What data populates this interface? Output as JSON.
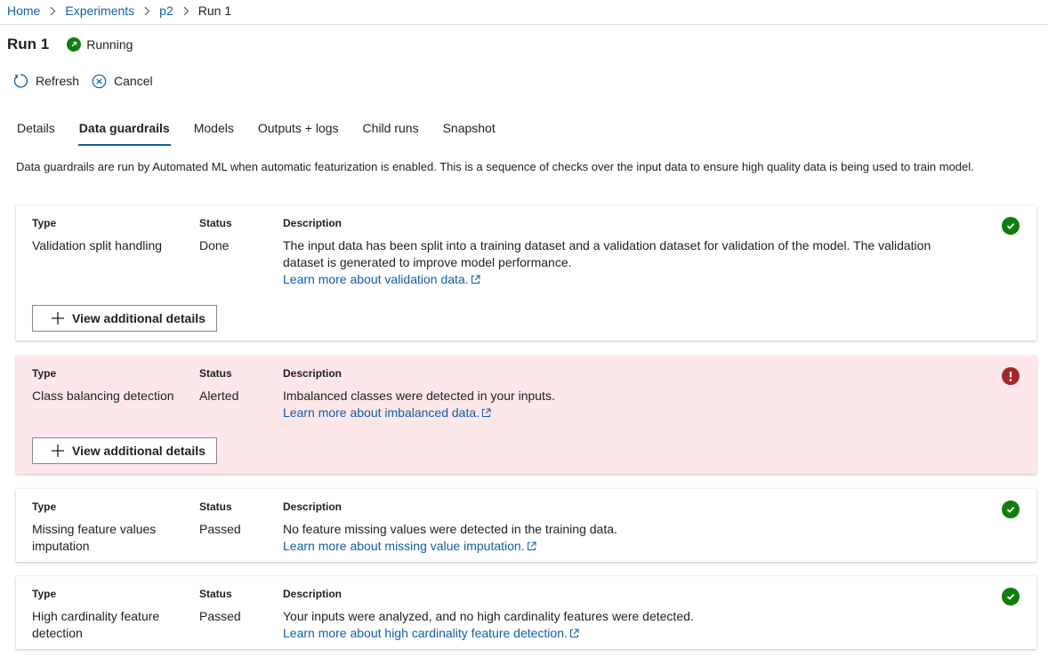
{
  "breadcrumb": {
    "items": [
      {
        "label": "Home"
      },
      {
        "label": "Experiments"
      },
      {
        "label": "p2"
      }
    ],
    "current": "Run 1"
  },
  "run": {
    "title": "Run 1",
    "status": "Running",
    "status_color": "#107c10"
  },
  "toolbar": {
    "refresh_label": "Refresh",
    "cancel_label": "Cancel"
  },
  "tabs": [
    {
      "label": "Details",
      "active": false
    },
    {
      "label": "Data guardrails",
      "active": true
    },
    {
      "label": "Models",
      "active": false
    },
    {
      "label": "Outputs + logs",
      "active": false
    },
    {
      "label": "Child runs",
      "active": false
    },
    {
      "label": "Snapshot",
      "active": false
    }
  ],
  "intro": "Data guardrails are run by Automated ML when automatic featurization is enabled. This is a sequence of checks over the input data to ensure high quality data is being used to train model.",
  "headers": {
    "type": "Type",
    "status": "Status",
    "description": "Description"
  },
  "details_button_label": "View additional details",
  "colors": {
    "accent": "#0f5ea8",
    "success": "#107c10",
    "alert": "#a4262c",
    "alert_background": "#fde7e9"
  },
  "guardrails": [
    {
      "type": "Validation split handling",
      "status": "Done",
      "description": "The input data has been split into a training dataset and a validation dataset for validation of the model. The validation dataset is generated to improve model performance.",
      "link": "Learn more about validation data.",
      "icon": "check-circle-icon"
    },
    {
      "type": "Class balancing detection",
      "status": "Alerted",
      "description": "Imbalanced classes were detected in your inputs.",
      "link": "Learn more about imbalanced data.",
      "icon": "alert-circle-icon"
    },
    {
      "type": "Missing feature values imputation",
      "status": "Passed",
      "description": "No feature missing values were detected in the training data.",
      "link": "Learn more about missing value imputation.",
      "icon": "check-circle-icon"
    },
    {
      "type": "High cardinality feature detection",
      "status": "Passed",
      "description": "Your inputs were analyzed, and no high cardinality features were detected.",
      "link": "Learn more about high cardinality feature detection.",
      "icon": "check-circle-icon"
    }
  ]
}
